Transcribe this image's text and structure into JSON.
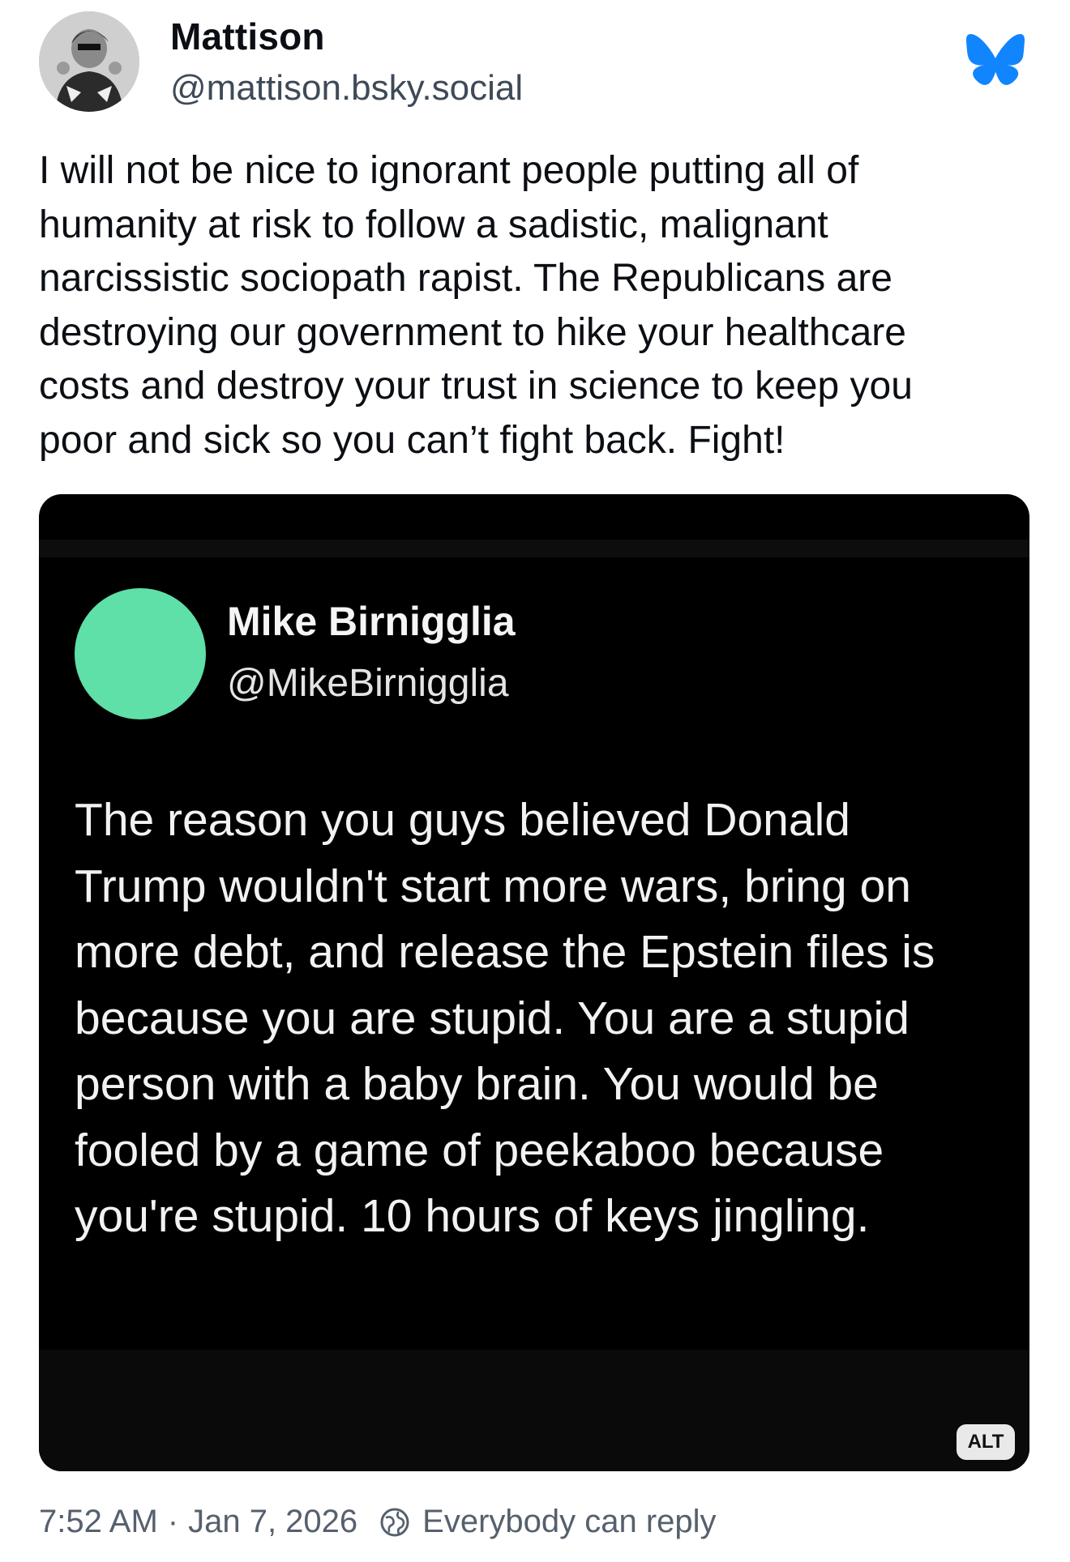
{
  "author": {
    "display_name": "Mattison",
    "handle": "@mattison.bsky.social"
  },
  "post": {
    "text_lines": [
      "I will not be nice to ignorant people putting all of",
      "humanity at risk to follow a sadistic, malignant",
      "narcissistic sociopath rapist. The Republicans are",
      "destroying our government to hike your healthcare",
      "costs and destroy your trust in science to keep you",
      "poor and sick so you can’t fight back. Fight!"
    ]
  },
  "embed": {
    "name": "Mike Birnigglia",
    "handle": "@MikeBirnigglia",
    "avatar_color": "#5ee0a8",
    "text_lines": [
      "The reason you guys believed Donald",
      "Trump wouldn't start more wars, bring on",
      "more debt, and release the Epstein files is",
      "because you are stupid. You are a stupid",
      "person with a baby brain. You would be",
      "fooled by a game of peekaboo because",
      "you're stupid. 10 hours of keys jingling."
    ],
    "alt_label": "ALT"
  },
  "footer": {
    "time": "7:52 AM",
    "separator": "·",
    "date": "Jan 7, 2026",
    "reply_setting": "Everybody can reply"
  },
  "icons": {
    "logo": "bluesky-butterfly-icon",
    "reply": "globe-icon"
  },
  "colors": {
    "brand": "#1185fe",
    "text": "#0b0f14",
    "muted": "#56606d"
  }
}
